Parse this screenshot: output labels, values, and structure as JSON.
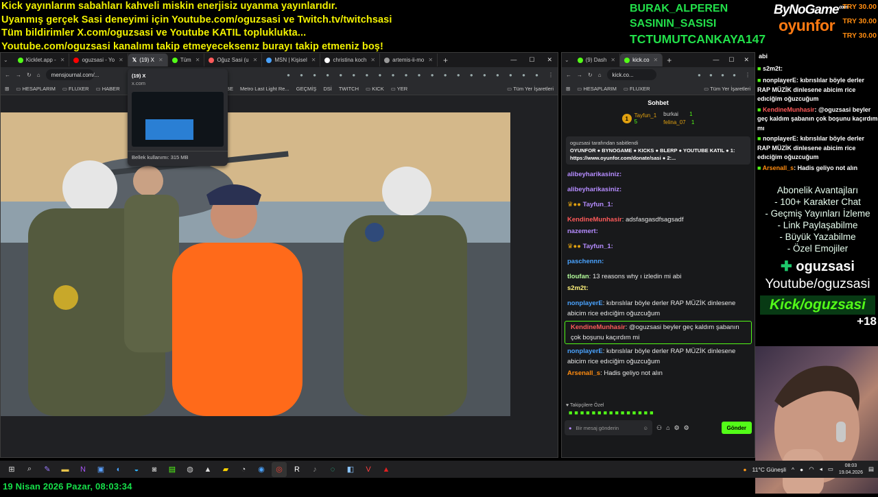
{
  "ticker": [
    "Kick yayınlarım sabahları kahveli miskin enerjisiz uyanma yayınlarıdır.",
    "Uyanmış gerçek Sasi deneyimi için Youtube.com/oguzsasi ve Twitch.tv/twitchsasi",
    "Tüm bildirimler X.com/oguzsasi ve Youtube KATIL topluklukta...",
    "Youtube.com/oguzsasi kanalımı takip etmeyeceksenız burayı takip etmeniz boş!"
  ],
  "names": [
    "BURAK_ALPEREN",
    "SASININ_SASISI",
    "TCTUMUTCANKAYA147"
  ],
  "sponsor": {
    "line1": "ByNoGame",
    "line1_small": ".com",
    "line2": "oyunfor"
  },
  "donations": [
    "TRY 30.00",
    "TRY 30.00",
    "TRY 30.00"
  ],
  "browser_left": {
    "tabs": [
      {
        "label": "Kicklet.app - ",
        "color": "#53fc18",
        "active": false
      },
      {
        "label": "oguzsasi - Yo",
        "color": "#ff0000",
        "active": false
      },
      {
        "label": "(19) X",
        "color": "#ffffff",
        "active": true
      },
      {
        "label": "Tüm",
        "color": "#53fc18",
        "active": false
      },
      {
        "label": "Oğuz Sasi (u",
        "color": "#ff5a5a",
        "active": false
      },
      {
        "label": "MSN | Kişisel",
        "color": "#4aa3ff",
        "active": false
      },
      {
        "label": "christina koch",
        "color": "#ffffff",
        "active": false
      },
      {
        "label": "artemis-ii-mo",
        "color": "#999999",
        "active": false
      }
    ],
    "url": "mensjournal.com/...",
    "bookmarks": [
      "HESAPLARIM",
      "FLUXER",
      "HABER",
      "UTUBE",
      "Metro Last Light Re...",
      "GEÇMİŞ",
      "DSİ",
      "TWITCH",
      "KICK",
      "YER",
      "Tüm Yer İşaretleri"
    ],
    "tooltip": {
      "title": "(19) X",
      "domain": "x.com",
      "memory": "Bellek kullanımı: 315 MB"
    }
  },
  "browser_right": {
    "tabs": [
      {
        "label": "(9) Dash",
        "color": "#53fc18"
      },
      {
        "label": "kick.co",
        "color": "#53fc18"
      }
    ],
    "url": "kick.co...",
    "bookmarks": [
      "HESAPLARIM",
      "FLUXER",
      "Tüm Yer İşaretleri"
    ],
    "chat_title": "Sohbet",
    "top_gifters": [
      {
        "rank": "1",
        "name": "Tayfun_1",
        "count": "5"
      },
      {
        "name": "burkai",
        "count": "1"
      },
      {
        "name": "felina_07",
        "count": "1"
      }
    ],
    "pinned": {
      "by": "oguzsasi tarafından sabitlendi",
      "text": "OYUNFOR ● BYNOGAME ● KICKS ● BLERP ● YOUTUBE KATIL ● 1: https://www.oyunfor.com/donate/sasi ● 2:..."
    },
    "messages": [
      {
        "user": "alibeyharikasiniz:",
        "color": "#b58cff",
        "text": ""
      },
      {
        "user": "alibeyharikasiniz:",
        "color": "#b58cff",
        "text": ""
      },
      {
        "user": "Tayfun_1:",
        "color": "#b58cff",
        "text": ""
      },
      {
        "user": "KendineMunhasir",
        "color": "#ff5a5a",
        "text": ": adsfasgasdfsagsadf"
      },
      {
        "user": "nazemert:",
        "color": "#b58cff",
        "text": ""
      },
      {
        "user": "Tayfun_1:",
        "color": "#b58cff",
        "text": ""
      },
      {
        "user": "paschennn:",
        "color": "#4aa3ff",
        "text": ""
      },
      {
        "user": "tloufan",
        "color": "#b5ff9c",
        "text": ": 13 reasons why ı izledin mi abi"
      },
      {
        "user": "s2m2t:",
        "color": "#fff27a",
        "text": ""
      },
      {
        "user": "nonplayerE",
        "color": "#4aa3ff",
        "text": ": kıbrıslılar böyle derler RAP MÜZİK dinlesene abicim rice edıciğim oğuzcuğum"
      },
      {
        "user": "KendineMunhasir",
        "color": "#ff5a5a",
        "text": ": @oguzsasi beyler geç kaldım şabanın çok boşunu kaçırdım mi"
      },
      {
        "user": "nonplayerE",
        "color": "#4aa3ff",
        "text": ": kıbrıslılar böyle derler RAP MÜZİK dinlesene abicim rice edıciğim oğuzcuğum"
      },
      {
        "user": "Arsenall_s",
        "color": "#ff8c10",
        "text": ": Hadis geliyo not alın"
      }
    ],
    "followers_only": "Takipçilere Özel",
    "input_placeholder": "Bir mesaj gönderin",
    "send_label": "Gönder"
  },
  "side_chat": [
    {
      "user": "abi",
      "text": ""
    },
    {
      "user": "s2m2t",
      "text": ":"
    },
    {
      "user": "nonplayerE",
      "text": ": kıbrıslılar böyle derler RAP MÜZİK dinlesene abicim rice edıciğim oğuzcuğum"
    },
    {
      "user": "KendineMunhasir",
      "text": ": @oguzsasi beyler geç kaldım şabanın çok boşunu kaçırdım mı"
    },
    {
      "user": "nonplayerE",
      "text": ": kıbrıslılar böyle derler RAP MÜZİK dinlesene abicim rice edıciğim oğuzcuğum"
    },
    {
      "user": "Arsenall_s",
      "text": ": Hadis geliyo not alın"
    }
  ],
  "perks": [
    "Abonelik Avantajları",
    "- 100+ Karakter Chat",
    "- Geçmiş Yayınları İzleme",
    "- Link Paylaşabilme",
    "- Büyük Yazabilme",
    "- Özel Emojiler"
  ],
  "social": {
    "kick_name": "oguzsasi",
    "youtube": "Youtube/oguzsasi",
    "kick_url": "Kick/oguzsasi",
    "age": "+18"
  },
  "taskbar": {
    "weather": "11°C  Güneşli",
    "time": "08:03",
    "date": "19.04.2026"
  },
  "clock": "19 Nisan 2026 Pazar, 08:03:34"
}
